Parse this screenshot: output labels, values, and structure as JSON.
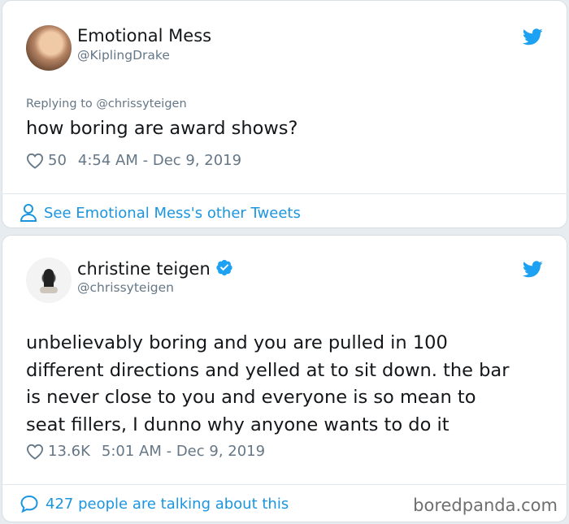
{
  "tweet1": {
    "display_name": "Emotional Mess",
    "handle": "@KiplingDrake",
    "replying_to": "Replying to @chrissyteigen",
    "text": "how boring are award shows?",
    "likes": "50",
    "timestamp": "4:54 AM - Dec 9, 2019",
    "footer_link": "See Emotional Mess's other Tweets"
  },
  "tweet2": {
    "display_name": "christine teigen",
    "handle": "@chrissyteigen",
    "text_lines": [
      "unbelievably boring and you are pulled in 100",
      "different directions and yelled at to sit down. the bar",
      "is never close to you and everyone is so mean to",
      "seat fillers, I dunno why anyone wants to do it"
    ],
    "likes": "13.6K",
    "timestamp": "5:01 AM - Dec 9, 2019",
    "footer_link": "427 people are talking about this"
  },
  "watermark": "boredpanda.com",
  "icons": {
    "bird": "twitter-bird-icon",
    "heart": "heart-icon",
    "person": "person-icon",
    "comment": "comment-bubble-icon",
    "verified": "verified-badge-icon"
  },
  "colors": {
    "accent": "#1b95e0",
    "text": "#14171a",
    "muted": "#657786"
  }
}
